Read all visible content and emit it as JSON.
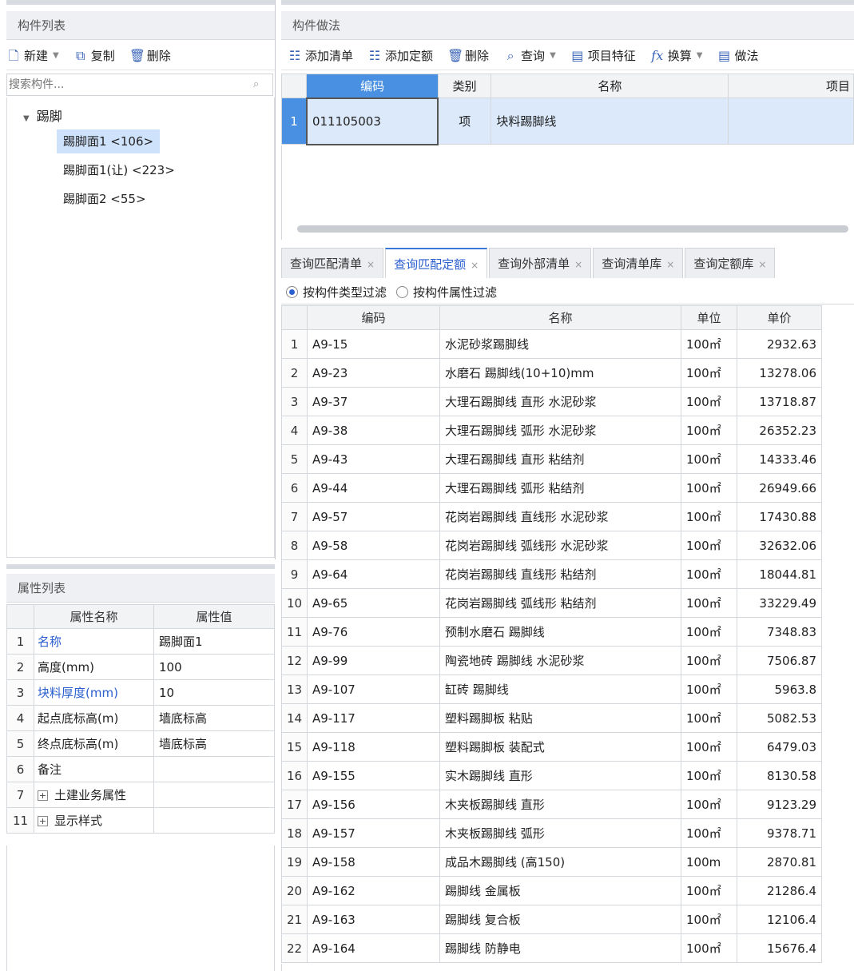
{
  "left": {
    "component_list_title": "构件列表",
    "toolbar": {
      "new_label": "新建",
      "copy_label": "复制",
      "delete_label": "删除"
    },
    "search_placeholder": "搜索构件...",
    "tree": {
      "root_label": "踢脚",
      "items": [
        {
          "label": "踢脚面1 <106>",
          "selected": true
        },
        {
          "label": "踢脚面1(让) <223>",
          "selected": false
        },
        {
          "label": "踢脚面2 <55>",
          "selected": false
        }
      ]
    },
    "properties": {
      "title": "属性列表",
      "col_name": "属性名称",
      "col_value": "属性值",
      "rows": [
        {
          "num": "1",
          "name": "名称",
          "value": "踢脚面1",
          "highlight": true
        },
        {
          "num": "2",
          "name": "高度(mm)",
          "value": "100",
          "highlight": false
        },
        {
          "num": "3",
          "name": "块料厚度(mm)",
          "value": "10",
          "highlight": true
        },
        {
          "num": "4",
          "name": "起点底标高(m)",
          "value": "墙底标高",
          "highlight": false
        },
        {
          "num": "5",
          "name": "终点底标高(m)",
          "value": "墙底标高",
          "highlight": false
        },
        {
          "num": "6",
          "name": "备注",
          "value": "",
          "highlight": false
        },
        {
          "num": "7",
          "name": "土建业务属性",
          "value": "",
          "expandable": true
        },
        {
          "num": "11",
          "name": "显示样式",
          "value": "",
          "expandable": true
        }
      ]
    }
  },
  "right": {
    "method_title": "构件做法",
    "toolbar": {
      "add_list": "添加清单",
      "add_quota": "添加定额",
      "delete": "删除",
      "query": "查询",
      "item_features": "项目特征",
      "convert": "换算",
      "do": "做法"
    },
    "top_table": {
      "headers": [
        "编码",
        "类别",
        "名称",
        "项目"
      ],
      "rows": [
        {
          "num": "1",
          "code": "011105003",
          "category": "项",
          "name": "块料踢脚线",
          "item": ""
        }
      ]
    },
    "tabs": [
      {
        "label": "查询匹配清单",
        "active": false
      },
      {
        "label": "查询匹配定额",
        "active": true
      },
      {
        "label": "查询外部清单",
        "active": false
      },
      {
        "label": "查询清单库",
        "active": false
      },
      {
        "label": "查询定额库",
        "active": false
      }
    ],
    "filter": {
      "by_type": "按构件类型过滤",
      "by_attr": "按构件属性过滤"
    },
    "quota_table": {
      "headers": [
        "编码",
        "名称",
        "单位",
        "单价"
      ],
      "rows": [
        [
          "1",
          "A9-15",
          "水泥砂浆踢脚线",
          "100㎡",
          "2932.63"
        ],
        [
          "2",
          "A9-23",
          "水磨石 踢脚线(10+10)mm",
          "100㎡",
          "13278.06"
        ],
        [
          "3",
          "A9-37",
          "大理石踢脚线 直形 水泥砂浆",
          "100㎡",
          "13718.87"
        ],
        [
          "4",
          "A9-38",
          "大理石踢脚线 弧形 水泥砂浆",
          "100㎡",
          "26352.23"
        ],
        [
          "5",
          "A9-43",
          "大理石踢脚线 直形 粘结剂",
          "100㎡",
          "14333.46"
        ],
        [
          "6",
          "A9-44",
          "大理石踢脚线 弧形 粘结剂",
          "100㎡",
          "26949.66"
        ],
        [
          "7",
          "A9-57",
          "花岗岩踢脚线 直线形 水泥砂浆",
          "100㎡",
          "17430.88"
        ],
        [
          "8",
          "A9-58",
          "花岗岩踢脚线 弧线形 水泥砂浆",
          "100㎡",
          "32632.06"
        ],
        [
          "9",
          "A9-64",
          "花岗岩踢脚线 直线形 粘结剂",
          "100㎡",
          "18044.81"
        ],
        [
          "10",
          "A9-65",
          "花岗岩踢脚线 弧线形 粘结剂",
          "100㎡",
          "33229.49"
        ],
        [
          "11",
          "A9-76",
          "预制水磨石 踢脚线",
          "100㎡",
          "7348.83"
        ],
        [
          "12",
          "A9-99",
          "陶瓷地砖 踢脚线 水泥砂浆",
          "100㎡",
          "7506.87"
        ],
        [
          "13",
          "A9-107",
          "缸砖 踢脚线",
          "100㎡",
          "5963.8"
        ],
        [
          "14",
          "A9-117",
          "塑料踢脚板 粘贴",
          "100㎡",
          "5082.53"
        ],
        [
          "15",
          "A9-118",
          "塑料踢脚板 装配式",
          "100㎡",
          "6479.03"
        ],
        [
          "16",
          "A9-155",
          "实木踢脚线 直形",
          "100㎡",
          "8130.58"
        ],
        [
          "17",
          "A9-156",
          "木夹板踢脚线 直形",
          "100㎡",
          "9123.29"
        ],
        [
          "18",
          "A9-157",
          "木夹板踢脚线 弧形",
          "100㎡",
          "9378.71"
        ],
        [
          "19",
          "A9-158",
          "成品木踢脚线 (高150)",
          "100m",
          "2870.81"
        ],
        [
          "20",
          "A9-162",
          "踢脚线 金属板",
          "100㎡",
          "21286.4"
        ],
        [
          "21",
          "A9-163",
          "踢脚线 复合板",
          "100㎡",
          "12106.4"
        ],
        [
          "22",
          "A9-164",
          "踢脚线 防静电",
          "100㎡",
          "15676.4"
        ]
      ]
    }
  }
}
